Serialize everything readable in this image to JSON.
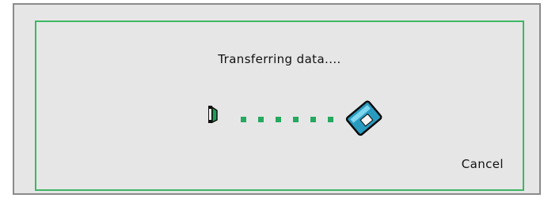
{
  "dialog": {
    "title": "Transferring data....",
    "cancel_label": "Cancel"
  },
  "transfer": {
    "source_icon": "phone-icon",
    "destination_icon": "memory-card-icon",
    "dot_count": 6,
    "colors": {
      "dots": "#24a95f",
      "panel_border": "#3fb665",
      "device": "#2a9bc0"
    }
  }
}
